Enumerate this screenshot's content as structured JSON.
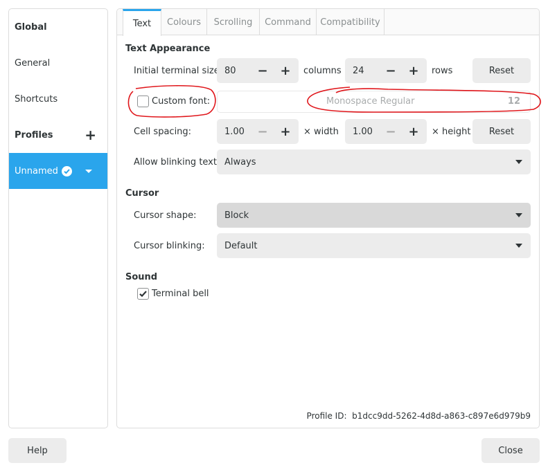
{
  "sidebar": {
    "global_label": "Global",
    "general_label": "General",
    "shortcuts_label": "Shortcuts",
    "profiles_label": "Profiles",
    "add_profile_symbol": "+",
    "selected_profile": "Unnamed"
  },
  "tabs": [
    "Text",
    "Colours",
    "Scrolling",
    "Command",
    "Compatibility"
  ],
  "text_appearance": {
    "title": "Text Appearance",
    "terminal_size_label": "Initial terminal size:",
    "columns_value": "80",
    "columns_unit": "columns",
    "rows_value": "24",
    "rows_unit": "rows",
    "reset_label": "Reset",
    "custom_font_label": "Custom font:",
    "custom_font_checked": false,
    "font_name": "Monospace Regular",
    "font_size": "12",
    "cell_spacing_label": "Cell spacing:",
    "width_value": "1.00",
    "width_unit": "× width",
    "height_value": "1.00",
    "height_unit": "× height",
    "blinking_text_label": "Allow blinking text:",
    "blinking_text_value": "Always"
  },
  "cursor": {
    "title": "Cursor",
    "shape_label": "Cursor shape:",
    "shape_value": "Block",
    "blinking_label": "Cursor blinking:",
    "blinking_value": "Default"
  },
  "sound": {
    "title": "Sound",
    "bell_label": "Terminal bell",
    "bell_checked": true
  },
  "profile_id_label": "Profile ID:",
  "profile_id_value": "b1dcc9dd-5262-4d8d-a863-c897e6d979b9",
  "footer": {
    "help_label": "Help",
    "close_label": "Close"
  },
  "colors": {
    "accent": "#2aa5ec",
    "annotation": "#e0161b"
  }
}
